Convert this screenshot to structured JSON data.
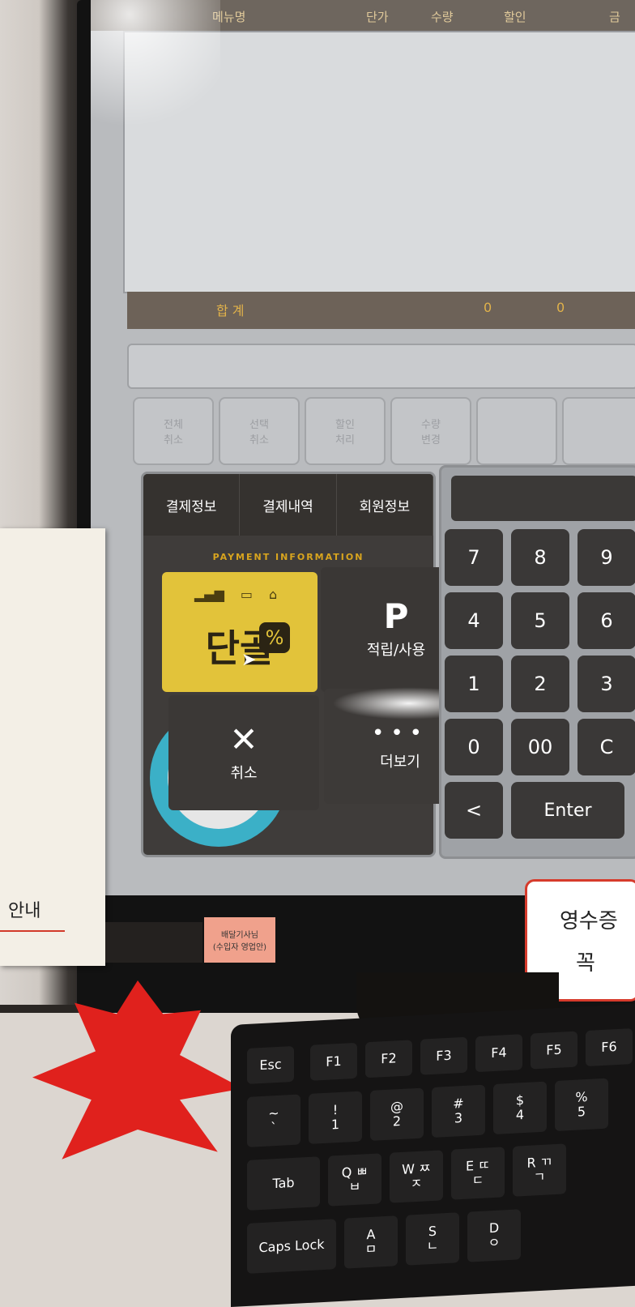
{
  "pos": {
    "column_headers": [
      "메뉴명",
      "단가",
      "수량",
      "할인",
      "금"
    ],
    "total_label": "합 계",
    "total_values": [
      "0",
      "0"
    ],
    "function_buttons": [
      "전체\n취소",
      "선택\n취소",
      "할인\n처리",
      "수량\n변경",
      "",
      ""
    ],
    "payment_tabs": [
      "결제정보",
      "결제내역",
      "회원정보"
    ],
    "payment_caption": "PAYMENT INFORMATION",
    "popup": {
      "terminal": {
        "label": "단골",
        "badge": "%"
      },
      "points": {
        "glyph": "P",
        "label": "적립/사용"
      },
      "cancel": {
        "glyph": "✕",
        "label": "취소"
      },
      "more": {
        "glyph": "•••",
        "label": "더보기"
      }
    },
    "numpad_keys": [
      "7",
      "8",
      "9",
      "4",
      "5",
      "6",
      "1",
      "2",
      "3",
      "0",
      "00",
      "C",
      "<",
      "Enter"
    ]
  },
  "environment": {
    "note_text": [
      "안내"
    ],
    "sticker_lines": [
      "배달기사님",
      "(수입자 영업안)"
    ],
    "receipt_sign": [
      "영수증",
      "꼭"
    ],
    "keyboard_keys": [
      {
        "top": "Esc"
      },
      {
        "top": "F1"
      },
      {
        "top": "F2"
      },
      {
        "top": "F3"
      },
      {
        "top": "F4"
      },
      {
        "top": "F5"
      },
      {
        "top": "F6"
      },
      {
        "top": "~",
        "bottom": "`"
      },
      {
        "top": "!",
        "bottom": "1"
      },
      {
        "top": "@",
        "bottom": "2"
      },
      {
        "top": "#",
        "bottom": "3"
      },
      {
        "top": "$",
        "bottom": "4"
      },
      {
        "top": "%",
        "bottom": "5"
      },
      {
        "top": "Tab"
      },
      {
        "top": "Q ㅃ",
        "bottom": "ㅂ"
      },
      {
        "top": "W ㅉ",
        "bottom": "ㅈ"
      },
      {
        "top": "E ㄸ",
        "bottom": "ㄷ"
      },
      {
        "top": "R ㄲ",
        "bottom": "ㄱ"
      },
      {
        "top": "Caps Lock"
      },
      {
        "top": "A",
        "bottom": "ㅁ"
      },
      {
        "top": "S",
        "bottom": "ㄴ"
      },
      {
        "top": "D",
        "bottom": "ㅇ"
      }
    ]
  },
  "colors": {
    "accent_yellow": "#e2c33a",
    "dark_panel": "#3f3c3a",
    "caption_gold": "#d9a51e"
  }
}
